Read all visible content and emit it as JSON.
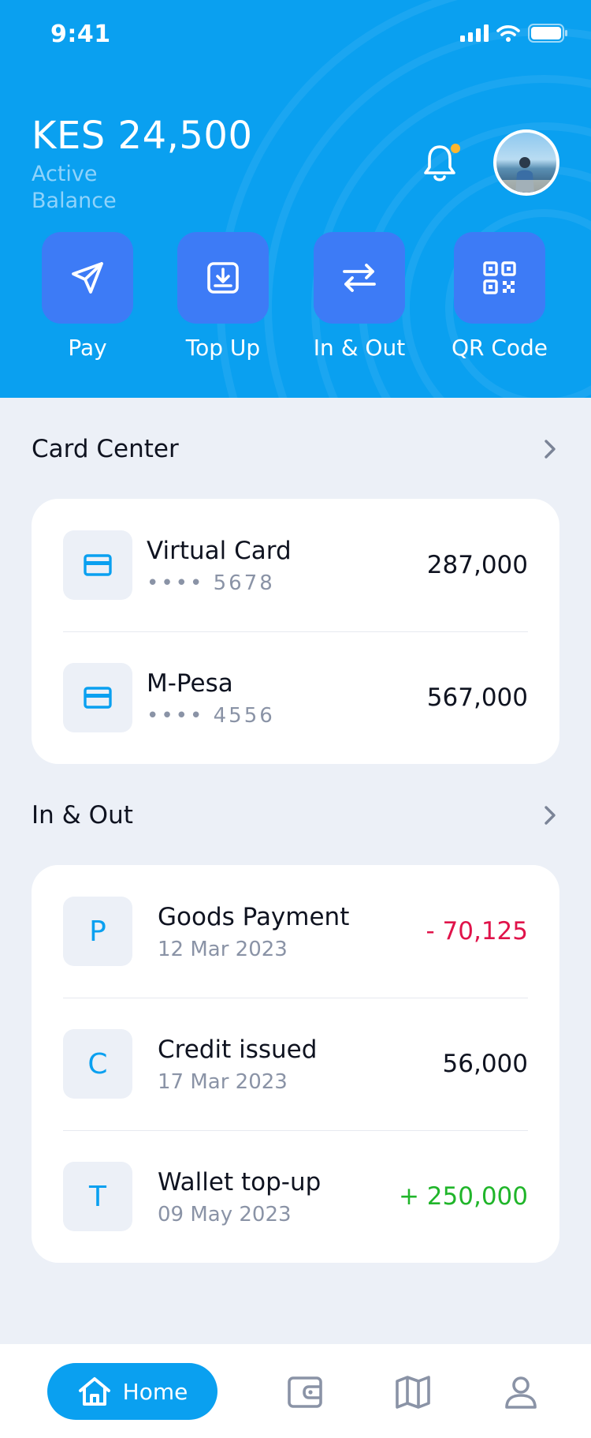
{
  "status": {
    "time": "9:41"
  },
  "balance": {
    "amount": "KES 24,500",
    "label": "Active Balance"
  },
  "actions": [
    {
      "label": "Pay",
      "icon": "send-icon"
    },
    {
      "label": "Top Up",
      "icon": "download-icon"
    },
    {
      "label": "In & Out",
      "icon": "transfer-icon"
    },
    {
      "label": "QR Code",
      "icon": "qr-code-icon"
    }
  ],
  "card_center": {
    "title": "Card Center",
    "cards": [
      {
        "name": "Virtual Card",
        "number": "•••• 5678",
        "amount": "287,000"
      },
      {
        "name": "M-Pesa",
        "number": "•••• 4556",
        "amount": "567,000"
      }
    ]
  },
  "in_out": {
    "title": "In & Out",
    "transactions": [
      {
        "initial": "P",
        "title": "Goods Payment",
        "date": "12 Mar 2023",
        "amount": "- 70,125",
        "kind": "negative"
      },
      {
        "initial": "C",
        "title": "Credit issued",
        "date": "17 Mar 2023",
        "amount": "56,000",
        "kind": "neutral"
      },
      {
        "initial": "T",
        "title": "Wallet top-up",
        "date": "09 May 2023",
        "amount": "+ 250,000",
        "kind": "positive"
      }
    ]
  },
  "nav": {
    "home_label": "Home",
    "items": [
      "home-icon",
      "wallet-icon",
      "map-icon",
      "profile-icon"
    ]
  },
  "colors": {
    "header": "#0AA0F0",
    "action_button": "#3D7BF6",
    "negative": "#E0134A",
    "positive": "#20B52A",
    "notification_dot": "#FDB62F"
  }
}
